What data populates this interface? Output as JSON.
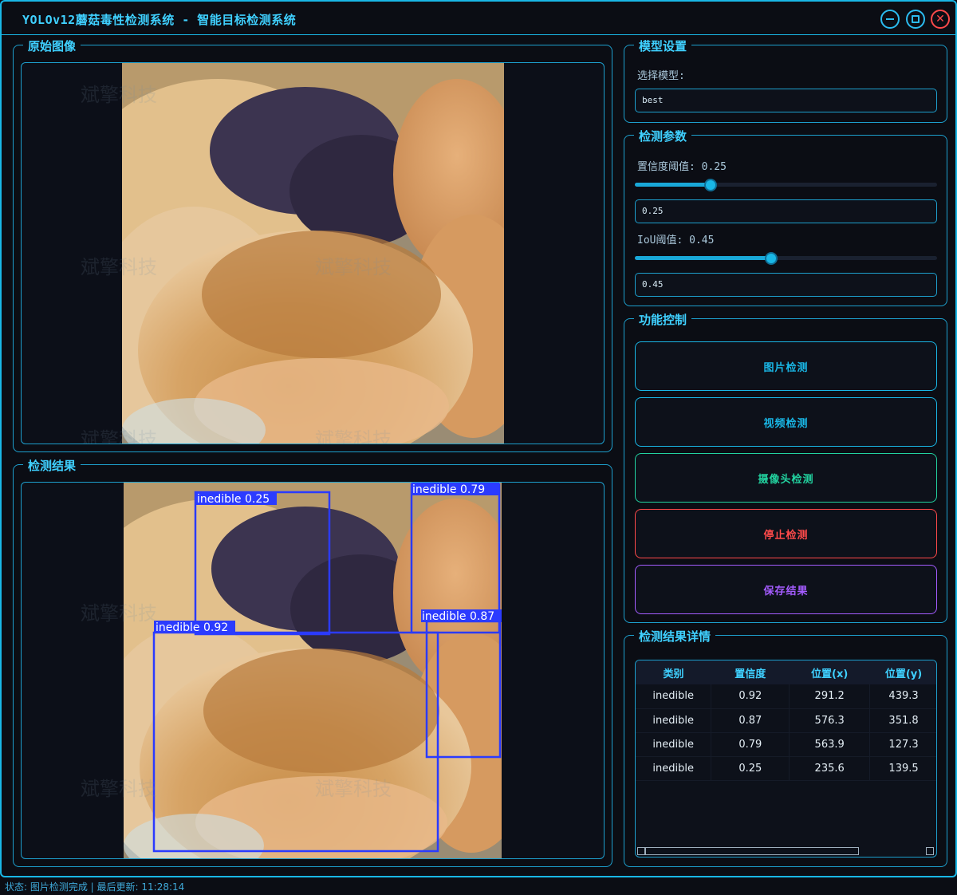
{
  "window": {
    "title": "YOLOv12蘑菇毒性检测系统 - 智能目标检测系统",
    "accent": "#19b7e6"
  },
  "original_panel": {
    "title": "原始图像"
  },
  "result_panel": {
    "title": "检测结果",
    "detections": [
      {
        "label": "inedible 0.25"
      },
      {
        "label": "inedible 0.79"
      },
      {
        "label": "inedible 0.87"
      },
      {
        "label": "inedible 0.92"
      }
    ]
  },
  "watermark": "斌擎科技",
  "model_settings": {
    "title": "模型设置",
    "select_label": "选择模型:",
    "selected_model": "best"
  },
  "params": {
    "title": "检测参数",
    "conf_label": "置信度阈值: 0.25",
    "conf_value": "0.25",
    "conf_level": 0.25,
    "iou_label": "IoU阈值: 0.45",
    "iou_value": "0.45",
    "iou_level": 0.45
  },
  "controls": {
    "title": "功能控制",
    "image_detect": "图片检测",
    "video_detect": "视频检测",
    "camera_detect": "摄像头检测",
    "stop_detect": "停止检测",
    "save_results": "保存结果",
    "colors": {
      "image": "#19b7e6",
      "video": "#19b7e6",
      "camera": "#22d3a0",
      "stop": "#ff4a4a",
      "save": "#a45cff"
    }
  },
  "details": {
    "title": "检测结果详情",
    "columns": [
      "类别",
      "置信度",
      "位置(x)",
      "位置(y)"
    ],
    "rows": [
      [
        "inedible",
        "0.92",
        "291.2",
        "439.3"
      ],
      [
        "inedible",
        "0.87",
        "576.3",
        "351.8"
      ],
      [
        "inedible",
        "0.79",
        "563.9",
        "127.3"
      ],
      [
        "inedible",
        "0.25",
        "235.6",
        "139.5"
      ]
    ]
  },
  "status": {
    "text": "状态: 图片检测完成 | 最后更新: 11:28:14"
  }
}
